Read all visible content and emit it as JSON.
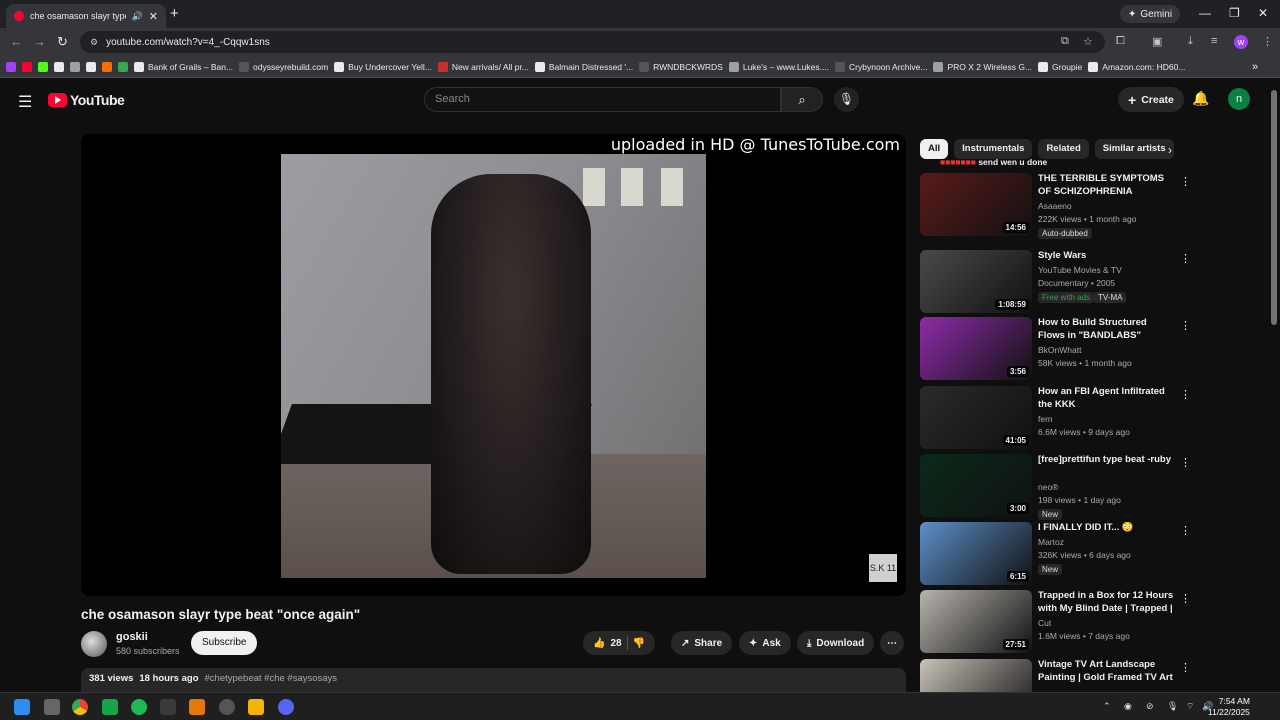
{
  "browser": {
    "tab_title": "che osamason slayr type be",
    "url": "youtube.com/watch?v=4_-Cqqw1sns",
    "gemini_label": "Gemini",
    "profile_initial": "w",
    "bookmarks": [
      {
        "label": "",
        "color": "#a142f4"
      },
      {
        "label": "",
        "color": "#ff0033"
      },
      {
        "label": "",
        "color": "#53fc18"
      },
      {
        "label": "",
        "color": "#e8eaed"
      },
      {
        "label": "",
        "color": "#9aa0a6"
      },
      {
        "label": "",
        "color": "#e8eaed"
      },
      {
        "label": "",
        "color": "#ff6d00"
      },
      {
        "label": "",
        "color": "#34a853"
      },
      {
        "label": "Bank of Grails – Ban...",
        "color": "#e8eaed"
      },
      {
        "label": "odysseyrebuild.com",
        "color": "#555"
      },
      {
        "label": "Buy Undercover Yell...",
        "color": "#e8eaed"
      },
      {
        "label": "New arrivals/ All pr...",
        "color": "#c6312d"
      },
      {
        "label": "Balmain Distressed '...",
        "color": "#e8eaed"
      },
      {
        "label": "RWNDBCKWRDS",
        "color": "#555"
      },
      {
        "label": "Luke's – www.Lukes....",
        "color": "#9aa0a6"
      },
      {
        "label": "Crybynoon Archive...",
        "color": "#555"
      },
      {
        "label": "PRO X 2 Wireless G...",
        "color": "#9aa0a6"
      },
      {
        "label": "Groupie",
        "color": "#e8eaed"
      },
      {
        "label": "Amazon.com: HD60...",
        "color": "#e8eaed"
      }
    ]
  },
  "youtube": {
    "logo_text": "YouTube",
    "search_placeholder": "Search",
    "create_label": "Create",
    "user_initial": "n"
  },
  "video": {
    "watermark": "uploaded in HD @ TunesToTube.com",
    "corner_badge": "S.K 11",
    "title": "che osamason slayr type beat \"once again\"",
    "channel": "goskii",
    "subscribers": "580 subscribers",
    "subscribe_label": "Subscribe",
    "likes": "28",
    "share_label": "Share",
    "ask_label": "Ask",
    "download_label": "Download",
    "views": "381 views",
    "age": "18 hours ago",
    "tags": "#chetypebeat #che #saysosays"
  },
  "sidebar": {
    "chips": [
      "All",
      "Instrumentals",
      "Related",
      "Similar artists"
    ],
    "peek_title": "send wen u done",
    "items": [
      {
        "title": "THE TERRIBLE SYMPTOMS OF SCHIZOPHRENIA",
        "channel": "Asaaeno",
        "meta": "222K views • 1 month ago",
        "badge": "Auto-dubbed",
        "duration": "14:56",
        "thumb": "#5a1a1a"
      },
      {
        "title": "Style Wars",
        "channel": "YouTube Movies & TV",
        "meta": "Documentary • 2005",
        "badge": "Free with ads",
        "badge2": "TV-MA",
        "duration": "1:08:59",
        "thumb": "#4a4a4a"
      },
      {
        "title": "How to Build Structured Flows in \"BANDLABS\" (Osamason ...",
        "channel": "BkOnWhatt",
        "meta": "58K views • 1 month ago",
        "duration": "3:56",
        "thumb": "#8e2ba8"
      },
      {
        "title": "How an FBI Agent Infiltrated the KKK",
        "channel": "fern",
        "meta": "6.6M views • 9 days ago",
        "duration": "41:05",
        "thumb": "#2a2a2a"
      },
      {
        "title": "[free]prettifun type beat -ruby",
        "channel": "neo®",
        "meta": "198 views • 1 day ago",
        "badge": "New",
        "duration": "3:00",
        "thumb": "#0a2a1a"
      },
      {
        "title": "I FINALLY DID IT... 😳",
        "channel": "Martoz",
        "meta": "326K views • 6 days ago",
        "badge": "New",
        "duration": "6:15",
        "thumb": "#5c8fc9"
      },
      {
        "title": "Trapped in a Box for 12 Hours with My Blind Date | Trapped | ...",
        "channel": "Cut",
        "meta": "1.6M views • 7 days ago",
        "duration": "27:51",
        "thumb": "#b8b4ae"
      },
      {
        "title": "Vintage TV Art Landscape Painting | Gold Framed TV Art ...",
        "channel": "",
        "meta": "",
        "duration": "",
        "thumb": "#c9c3b8"
      }
    ]
  },
  "taskbar": {
    "time": "7:54 AM",
    "date": "11/22/2025"
  }
}
